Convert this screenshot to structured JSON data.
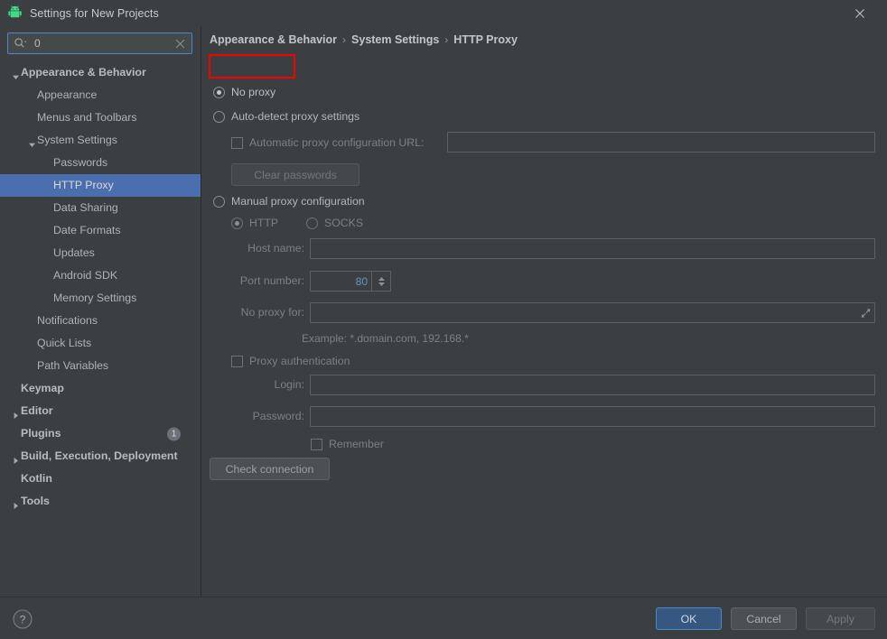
{
  "window": {
    "title": "Settings for New Projects",
    "icon": "android-icon",
    "close_label": "×"
  },
  "search": {
    "value": "0",
    "icon": "search-icon",
    "clear_icon": "clear-icon"
  },
  "sidebar": {
    "items": [
      {
        "label": "Appearance & Behavior",
        "indent": 0,
        "arrow": "down",
        "bold": true,
        "selected": false
      },
      {
        "label": "Appearance",
        "indent": 1,
        "arrow": "none",
        "bold": false,
        "selected": false
      },
      {
        "label": "Menus and Toolbars",
        "indent": 1,
        "arrow": "none",
        "bold": false,
        "selected": false
      },
      {
        "label": "System Settings",
        "indent": 1,
        "arrow": "down",
        "bold": false,
        "selected": false
      },
      {
        "label": "Passwords",
        "indent": 2,
        "arrow": "none",
        "bold": false,
        "selected": false
      },
      {
        "label": "HTTP Proxy",
        "indent": 2,
        "arrow": "none",
        "bold": false,
        "selected": true
      },
      {
        "label": "Data Sharing",
        "indent": 2,
        "arrow": "none",
        "bold": false,
        "selected": false
      },
      {
        "label": "Date Formats",
        "indent": 2,
        "arrow": "none",
        "bold": false,
        "selected": false
      },
      {
        "label": "Updates",
        "indent": 2,
        "arrow": "none",
        "bold": false,
        "selected": false
      },
      {
        "label": "Android SDK",
        "indent": 2,
        "arrow": "none",
        "bold": false,
        "selected": false
      },
      {
        "label": "Memory Settings",
        "indent": 2,
        "arrow": "none",
        "bold": false,
        "selected": false
      },
      {
        "label": "Notifications",
        "indent": 1,
        "arrow": "none",
        "bold": false,
        "selected": false
      },
      {
        "label": "Quick Lists",
        "indent": 1,
        "arrow": "none",
        "bold": false,
        "selected": false
      },
      {
        "label": "Path Variables",
        "indent": 1,
        "arrow": "none",
        "bold": false,
        "selected": false
      },
      {
        "label": "Keymap",
        "indent": 0,
        "arrow": "none",
        "bold": true,
        "selected": false
      },
      {
        "label": "Editor",
        "indent": 0,
        "arrow": "right",
        "bold": true,
        "selected": false
      },
      {
        "label": "Plugins",
        "indent": 0,
        "arrow": "none",
        "bold": true,
        "selected": false,
        "badge": "1"
      },
      {
        "label": "Build, Execution, Deployment",
        "indent": 0,
        "arrow": "right",
        "bold": true,
        "selected": false
      },
      {
        "label": "Kotlin",
        "indent": 0,
        "arrow": "none",
        "bold": true,
        "selected": false
      },
      {
        "label": "Tools",
        "indent": 0,
        "arrow": "right",
        "bold": true,
        "selected": false
      }
    ]
  },
  "breadcrumb": {
    "part1": "Appearance & Behavior",
    "sep1": "›",
    "part2": "System Settings",
    "sep2": "›",
    "part3": "HTTP Proxy"
  },
  "proxy": {
    "no_proxy_label": "No proxy",
    "no_proxy_selected": true,
    "auto_detect_label": "Auto-detect proxy settings",
    "auto_detect_selected": false,
    "auto_config_url_label": "Automatic proxy configuration URL:",
    "auto_config_url_checked": false,
    "auto_config_url_value": "",
    "clear_passwords_label": "Clear passwords",
    "manual_label": "Manual proxy configuration",
    "manual_selected": false,
    "http_label": "HTTP",
    "http_selected": true,
    "socks_label": "SOCKS",
    "socks_selected": false,
    "host_name_label": "Host name:",
    "host_name_value": "",
    "port_number_label": "Port number:",
    "port_number_value": "80",
    "no_proxy_for_label": "No proxy for:",
    "no_proxy_for_value": "",
    "no_proxy_for_expand_icon": "expand-icon",
    "example_hint": "Example: *.domain.com, 192.168.*",
    "proxy_auth_label": "Proxy authentication",
    "proxy_auth_checked": false,
    "login_label": "Login:",
    "login_value": "",
    "password_label": "Password:",
    "password_value": "",
    "remember_label": "Remember",
    "remember_checked": false,
    "check_connection_label": "Check connection"
  },
  "annotation": {
    "highlight_color": "#f40000",
    "target": "No proxy"
  },
  "footer": {
    "help_icon": "help-icon",
    "ok_label": "OK",
    "cancel_label": "Cancel",
    "apply_label": "Apply"
  }
}
